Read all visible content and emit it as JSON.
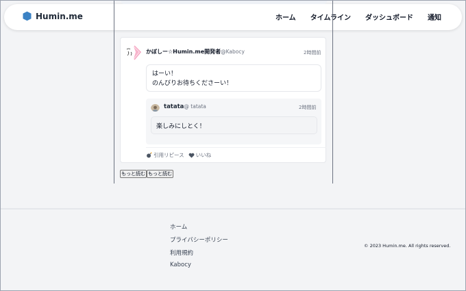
{
  "header": {
    "logo_text": "Humin.me",
    "logo_color": "#3b82c4",
    "nav": [
      "ホーム",
      "タイムライン",
      "ダッシュボード",
      "通知"
    ]
  },
  "post": {
    "author": "かぼしー☆Humin.me開発者",
    "handle": "@Kabocy",
    "time": "2時間前",
    "body_line1": "はーい！",
    "body_line2": "のんびりお待ちくださーい！",
    "quote": {
      "author": "tatata",
      "handle": "@ tatata",
      "time": "2時間前",
      "body": "楽しみにしとく！"
    },
    "actions": {
      "quote_repost": "引用リピース",
      "like": "いいね"
    }
  },
  "more_buttons": [
    "もっと読む",
    "もっと読む"
  ],
  "footer": {
    "links": [
      "ホーム",
      "プライバシーポリシー",
      "利用規約",
      "Kabocy"
    ],
    "copyright": "© 2023 Humin.me. All rights reserved."
  }
}
